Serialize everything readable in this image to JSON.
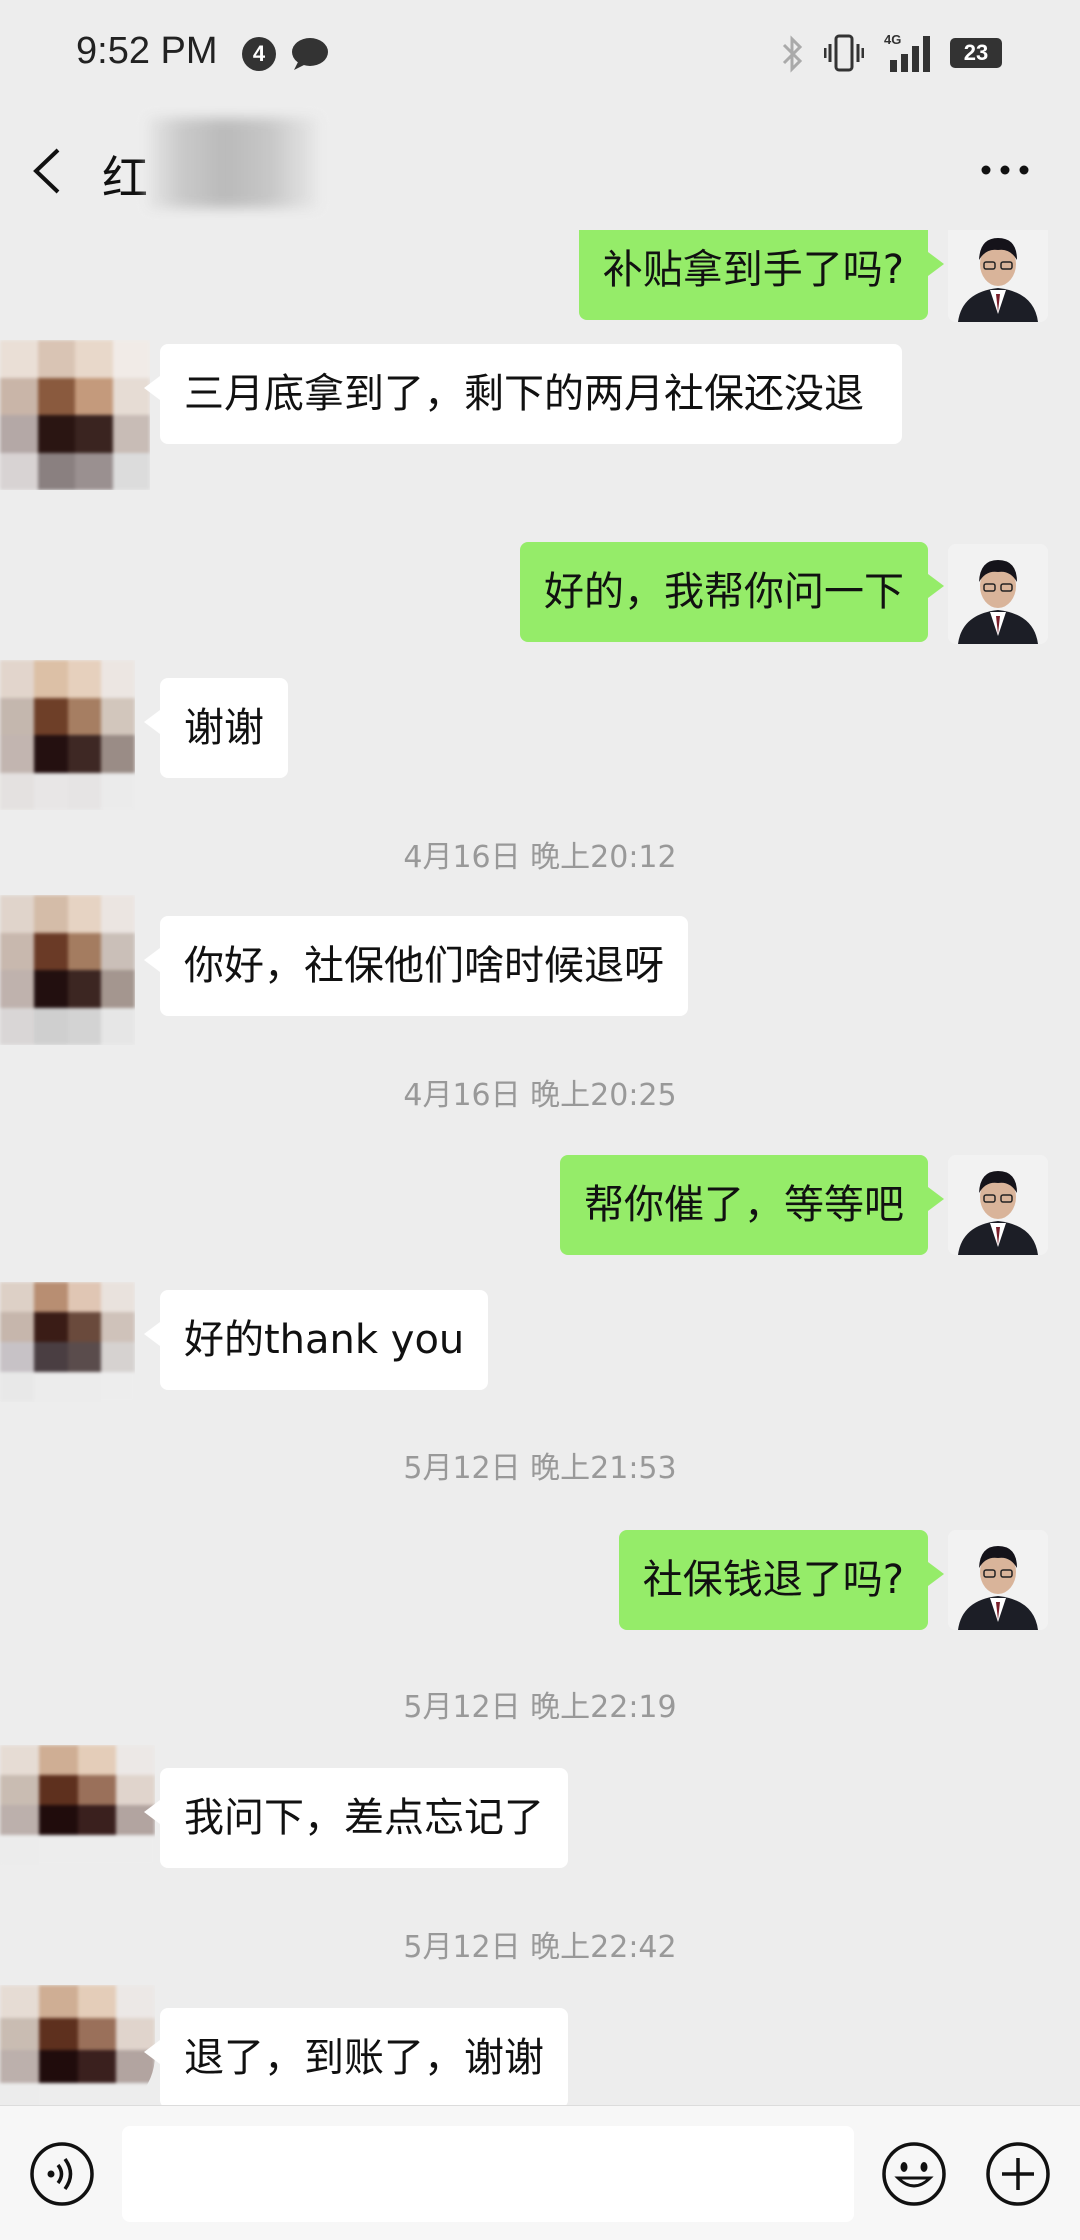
{
  "status_bar": {
    "time": "9:52 PM",
    "notification_count": "4",
    "battery": "23"
  },
  "header": {
    "title": "红"
  },
  "messages": [
    {
      "type": "message",
      "sender": "self",
      "text": "补贴拿到手了吗?"
    },
    {
      "type": "message",
      "sender": "other",
      "text": "三月底拿到了，剩下的两月社保还没退"
    },
    {
      "type": "message",
      "sender": "self",
      "text": "好的，我帮你问一下"
    },
    {
      "type": "message",
      "sender": "other",
      "text": "谢谢"
    },
    {
      "type": "timestamp",
      "text": "4月16日 晚上20:12"
    },
    {
      "type": "message",
      "sender": "other",
      "text": "你好，社保他们啥时候退呀"
    },
    {
      "type": "timestamp",
      "text": "4月16日 晚上20:25"
    },
    {
      "type": "message",
      "sender": "self",
      "text": "帮你催了，等等吧"
    },
    {
      "type": "message",
      "sender": "other",
      "text": "好的thank you"
    },
    {
      "type": "timestamp",
      "text": "5月12日 晚上21:53"
    },
    {
      "type": "message",
      "sender": "self",
      "text": "社保钱退了吗?"
    },
    {
      "type": "timestamp",
      "text": "5月12日 晚上22:19"
    },
    {
      "type": "message",
      "sender": "other",
      "text": "我问下，差点忘记了"
    },
    {
      "type": "timestamp",
      "text": "5月12日 晚上22:42"
    },
    {
      "type": "message",
      "sender": "other",
      "text": "退了，到账了，谢谢"
    }
  ],
  "input_bar": {
    "input_value": "",
    "icons": [
      "voice-icon",
      "emoji-icon",
      "plus-icon"
    ]
  },
  "colors": {
    "self_bubble": "#95ec69",
    "other_bubble": "#ffffff",
    "background": "#ededed",
    "timestamp_text": "#999999"
  }
}
